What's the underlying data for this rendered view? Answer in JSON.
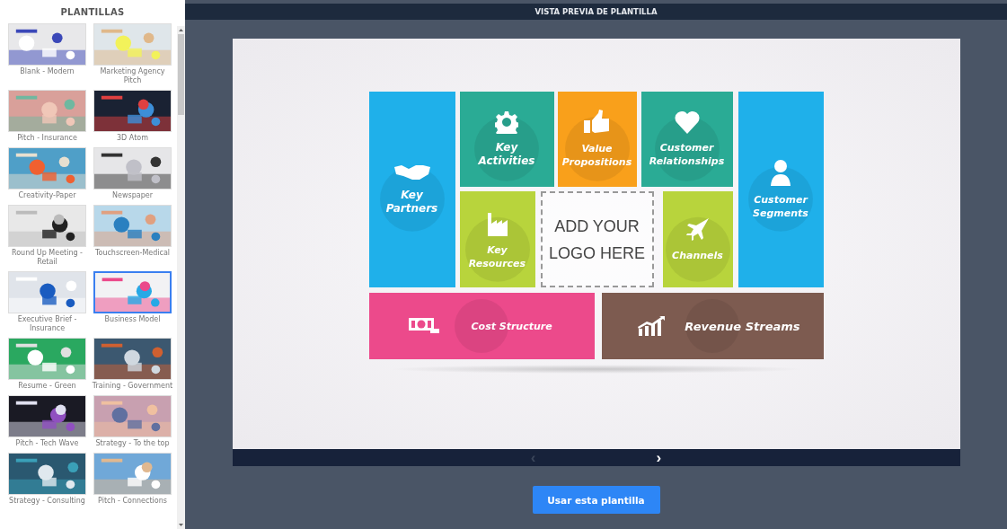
{
  "sidebar": {
    "title": "PLANTILLAS",
    "templates": [
      {
        "label": "Blank - Modern",
        "selected": false
      },
      {
        "label": "Marketing Agency Pitch",
        "selected": false
      },
      {
        "label": "Pitch - Insurance",
        "selected": false
      },
      {
        "label": "3D Atom",
        "selected": false
      },
      {
        "label": "Creativity-Paper",
        "selected": false
      },
      {
        "label": "Newspaper",
        "selected": false
      },
      {
        "label": "Round Up Meeting - Retail",
        "selected": false
      },
      {
        "label": "Touchscreen-Medical",
        "selected": false
      },
      {
        "label": "Executive Brief - Insurance",
        "selected": false
      },
      {
        "label": "Business Model",
        "selected": true
      },
      {
        "label": "Resume - Green",
        "selected": false
      },
      {
        "label": "Training - Government",
        "selected": false
      },
      {
        "label": "Pitch - Tech Wave",
        "selected": false
      },
      {
        "label": "Strategy - To the top",
        "selected": false
      },
      {
        "label": "Strategy - Consulting",
        "selected": false
      },
      {
        "label": "Pitch - Connections",
        "selected": false
      }
    ]
  },
  "preview": {
    "title": "VISTA PREVIA DE PLANTILLA",
    "slide": {
      "blocks": [
        {
          "kind": "block",
          "label": "Key Partners",
          "color": "#1fb0ea"
        },
        {
          "kind": "block",
          "label": "Key Activities",
          "color": "#2aab95"
        },
        {
          "kind": "block",
          "label": "Value Propositions",
          "color": "#f9a01b"
        },
        {
          "kind": "block",
          "label": "Customer Relationships",
          "color": "#2aab95"
        },
        {
          "kind": "block",
          "label": "Customer Segments",
          "color": "#1fb0ea"
        },
        {
          "kind": "block",
          "label": "Key Resources",
          "color": "#b8d43c"
        },
        {
          "kind": "logo",
          "label": "ADD YOUR LOGO HERE"
        },
        {
          "kind": "block",
          "label": "Channels",
          "color": "#b8d43c"
        }
      ],
      "bottom": [
        {
          "label": "Cost Structure",
          "color": "#ec4a8b"
        },
        {
          "label": "Revenue Streams",
          "color": "#7d5b50"
        }
      ]
    },
    "prev_disabled": true,
    "next_disabled": false,
    "next": "›",
    "prev": "‹",
    "use_button": "Usar esta plantilla"
  }
}
